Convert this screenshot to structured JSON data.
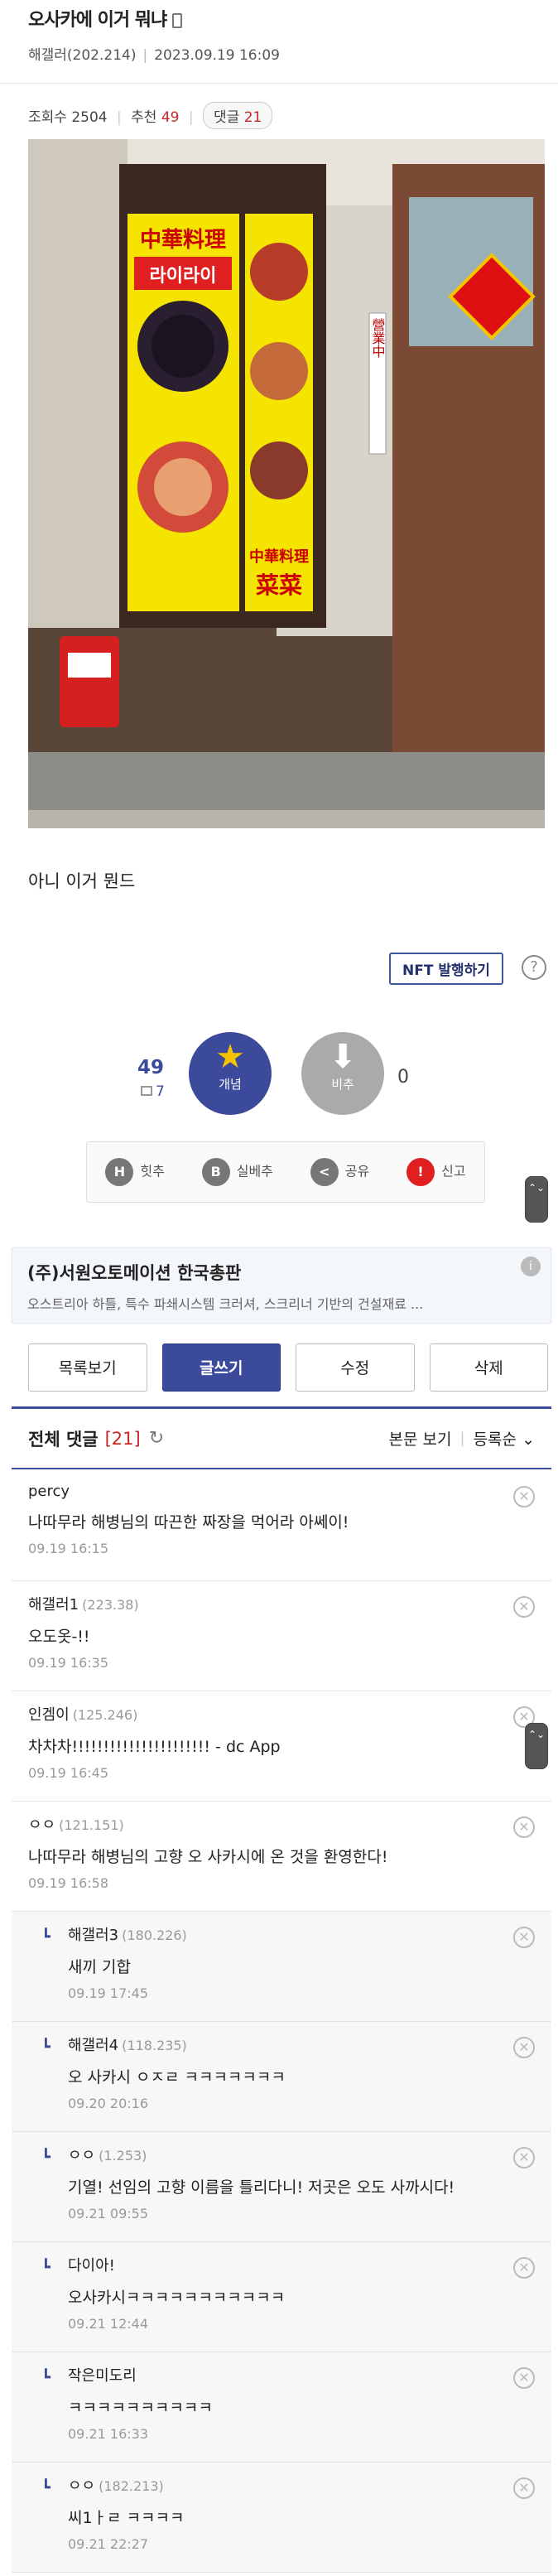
{
  "post": {
    "title": "오사카에 이거 뭐냐",
    "author": "해갤러(202.214)",
    "datetime": "2023.09.19 16:09",
    "views_label": "조회수 2504",
    "recommend_label": "추천",
    "recommend_count": "49",
    "comment_label": "댓글",
    "comment_count": "21",
    "body": "아니 이거 뭔드",
    "image_sign": {
      "top": "中華料理",
      "mid": "라이라이",
      "vert": "營業中",
      "bottom": "中華料理",
      "bottom2": "菜菜"
    }
  },
  "nft": {
    "label": "NFT 발행하기",
    "help": "?"
  },
  "vote": {
    "up_count": "49",
    "up_sub": "7",
    "up_label": "개념",
    "down_label": "비추",
    "down_count": "0"
  },
  "actions": [
    {
      "icon": "H",
      "label": "힛추"
    },
    {
      "icon": "B",
      "label": "실베추"
    },
    {
      "icon": "<",
      "label": "공유"
    },
    {
      "icon": "!",
      "label": "신고"
    }
  ],
  "ad": {
    "title": "(주)서원오토메이션 한국총판",
    "subtitle": "오스트리아 하틀, 특수 파쇄시스템 크러셔, 스크리너 기반의 건설재료 ..."
  },
  "buttons": {
    "list": "목록보기",
    "write": "글쓰기",
    "edit": "수정",
    "delete": "삭제"
  },
  "comments_header": {
    "title": "전체 댓글",
    "count": "[21]",
    "view_body": "본문 보기",
    "sort": "등록순"
  },
  "comments": [
    {
      "nick": "percy",
      "ip": "",
      "text": "나따무라 해병님의 따끈한 짜장을 먹어라 아쎄이!",
      "date": "09.19 16:15",
      "reply": false
    },
    {
      "nick": "해갤러1",
      "ip": "(223.38)",
      "text": "오도옷-!!",
      "date": "09.19 16:35",
      "reply": false
    },
    {
      "nick": "인겜이",
      "ip": "(125.246)",
      "text": "차차차!!!!!!!!!!!!!!!!!!!!!! - dc App",
      "date": "09.19 16:45",
      "reply": false
    },
    {
      "nick": "ㅇㅇ",
      "ip": "(121.151)",
      "text": "나따무라 해병님의 고향 오 사카시에 온 것을 환영한다!",
      "date": "09.19 16:58",
      "reply": false
    },
    {
      "nick": "해갤러3",
      "ip": "(180.226)",
      "text": "새끼 기합",
      "date": "09.19 17:45",
      "reply": true
    },
    {
      "nick": "해갤러4",
      "ip": "(118.235)",
      "text": "오 사카시 ㅇㅈㄹ ㅋㅋㅋㅋㅋㅋㅋ",
      "date": "09.20 20:16",
      "reply": true
    },
    {
      "nick": "ㅇㅇ",
      "ip": "(1.253)",
      "text": "기열! 선임의 고향 이름을 틀리다니! 저곳은 오도 사까시다!",
      "date": "09.21 09:55",
      "reply": true
    },
    {
      "nick": "다이아!",
      "ip": "",
      "text": "오사카시ㅋㅋㅋㅋㅋㅋㅋㅋㅋㅋㅋ",
      "date": "09.21 12:44",
      "reply": true
    },
    {
      "nick": "작은미도리",
      "ip": "",
      "text": "ㅋㅋㅋㅋㅋㅋㅋㅋㅋㅋ",
      "date": "09.21 16:33",
      "reply": true
    },
    {
      "nick": "ㅇㅇ",
      "ip": "(182.213)",
      "text": "씨1ㅏㄹ ㅋㅋㅋㅋ",
      "date": "09.21 22:27",
      "reply": true
    }
  ],
  "colors": {
    "accent": "#3b4a9a",
    "red": "#c62828"
  }
}
